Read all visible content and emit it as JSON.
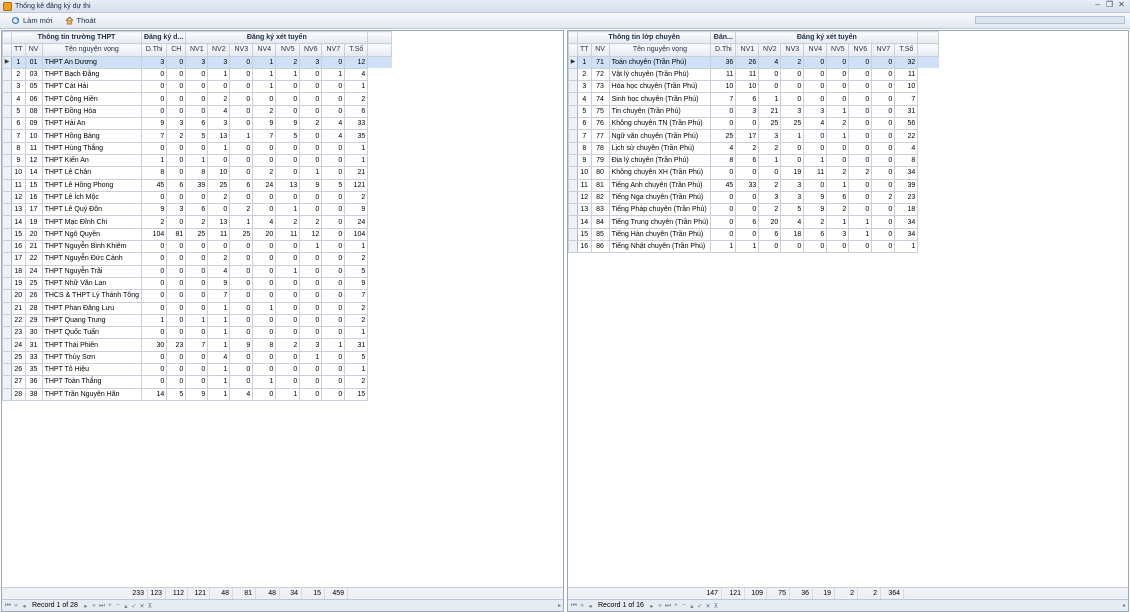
{
  "window": {
    "title": "Thống kê đăng ký dự thi"
  },
  "toolbar": {
    "refresh_label": "Làm mới",
    "exit_label": "Thoát"
  },
  "left_grid": {
    "band": [
      "Thông tin trường THPT",
      "Đăng ký d...",
      "Đăng ký xét tuyển"
    ],
    "columns": [
      "TT",
      "NV",
      "Tên nguyện vọng",
      "D.Thi",
      "CH",
      "NV1",
      "NV2",
      "NV3",
      "NV4",
      "NV5",
      "NV6",
      "NV7",
      "T.Số"
    ],
    "rows": [
      [
        "1",
        "01",
        "THPT An Dương",
        "3",
        "0",
        "3",
        "3",
        "0",
        "1",
        "2",
        "3",
        "0",
        "12"
      ],
      [
        "2",
        "03",
        "THPT Bạch Đằng",
        "0",
        "0",
        "0",
        "1",
        "0",
        "1",
        "1",
        "0",
        "1",
        "4"
      ],
      [
        "3",
        "05",
        "THPT Cát Hải",
        "0",
        "0",
        "0",
        "0",
        "0",
        "1",
        "0",
        "0",
        "0",
        "1"
      ],
      [
        "4",
        "06",
        "THPT Cộng Hiền",
        "0",
        "0",
        "0",
        "2",
        "0",
        "0",
        "0",
        "0",
        "0",
        "2"
      ],
      [
        "5",
        "08",
        "THPT Đồng Hòa",
        "0",
        "0",
        "0",
        "4",
        "0",
        "2",
        "0",
        "0",
        "0",
        "6"
      ],
      [
        "6",
        "09",
        "THPT Hải An",
        "9",
        "3",
        "6",
        "3",
        "0",
        "9",
        "9",
        "2",
        "4",
        "33"
      ],
      [
        "7",
        "10",
        "THPT Hồng Bàng",
        "7",
        "2",
        "5",
        "13",
        "1",
        "7",
        "5",
        "0",
        "4",
        "35"
      ],
      [
        "8",
        "11",
        "THPT Hùng Thắng",
        "0",
        "0",
        "0",
        "1",
        "0",
        "0",
        "0",
        "0",
        "0",
        "1"
      ],
      [
        "9",
        "12",
        "THPT Kiến An",
        "1",
        "0",
        "1",
        "0",
        "0",
        "0",
        "0",
        "0",
        "0",
        "1"
      ],
      [
        "10",
        "14",
        "THPT Lê Chân",
        "8",
        "0",
        "8",
        "10",
        "0",
        "2",
        "0",
        "1",
        "0",
        "21"
      ],
      [
        "11",
        "15",
        "THPT Lê Hồng Phong",
        "45",
        "6",
        "39",
        "25",
        "6",
        "24",
        "13",
        "9",
        "5",
        "121"
      ],
      [
        "12",
        "16",
        "THPT Lê Ích Mộc",
        "0",
        "0",
        "0",
        "2",
        "0",
        "0",
        "0",
        "0",
        "0",
        "2"
      ],
      [
        "13",
        "17",
        "THPT Lê Quý Đôn",
        "9",
        "3",
        "6",
        "0",
        "2",
        "0",
        "1",
        "0",
        "0",
        "9"
      ],
      [
        "14",
        "19",
        "THPT Mạc Đĩnh Chi",
        "2",
        "0",
        "2",
        "13",
        "1",
        "4",
        "2",
        "2",
        "0",
        "24"
      ],
      [
        "15",
        "20",
        "THPT Ngô Quyền",
        "104",
        "81",
        "25",
        "11",
        "25",
        "20",
        "11",
        "12",
        "0",
        "104"
      ],
      [
        "16",
        "21",
        "THPT Nguyễn Bỉnh Khiêm",
        "0",
        "0",
        "0",
        "0",
        "0",
        "0",
        "0",
        "1",
        "0",
        "1"
      ],
      [
        "17",
        "22",
        "THPT Nguyễn Đức Cảnh",
        "0",
        "0",
        "0",
        "2",
        "0",
        "0",
        "0",
        "0",
        "0",
        "2"
      ],
      [
        "18",
        "24",
        "THPT Nguyễn Trãi",
        "0",
        "0",
        "0",
        "4",
        "0",
        "0",
        "1",
        "0",
        "0",
        "5"
      ],
      [
        "19",
        "25",
        "THPT Nhữ Văn Lan",
        "0",
        "0",
        "0",
        "9",
        "0",
        "0",
        "0",
        "0",
        "0",
        "9"
      ],
      [
        "20",
        "26",
        "THCS & THPT Lý Thánh Tông",
        "0",
        "0",
        "0",
        "7",
        "0",
        "0",
        "0",
        "0",
        "0",
        "7"
      ],
      [
        "21",
        "28",
        "THPT Phan Đăng Lưu",
        "0",
        "0",
        "0",
        "1",
        "0",
        "1",
        "0",
        "0",
        "0",
        "2"
      ],
      [
        "22",
        "29",
        "THPT Quang Trung",
        "1",
        "0",
        "1",
        "1",
        "0",
        "0",
        "0",
        "0",
        "0",
        "2"
      ],
      [
        "23",
        "30",
        "THPT Quốc Tuấn",
        "0",
        "0",
        "0",
        "1",
        "0",
        "0",
        "0",
        "0",
        "0",
        "1"
      ],
      [
        "24",
        "31",
        "THPT Thái Phiên",
        "30",
        "23",
        "7",
        "1",
        "9",
        "8",
        "2",
        "3",
        "1",
        "31"
      ],
      [
        "25",
        "33",
        "THPT Thủy Sơn",
        "0",
        "0",
        "0",
        "4",
        "0",
        "0",
        "0",
        "1",
        "0",
        "5"
      ],
      [
        "26",
        "35",
        "THPT Tô Hiệu",
        "0",
        "0",
        "0",
        "1",
        "0",
        "0",
        "0",
        "0",
        "0",
        "1"
      ],
      [
        "27",
        "36",
        "THPT Toàn Thắng",
        "0",
        "0",
        "0",
        "1",
        "0",
        "1",
        "0",
        "0",
        "0",
        "2"
      ],
      [
        "28",
        "38",
        "THPT Trần Nguyên Hãn",
        "14",
        "5",
        "9",
        "1",
        "4",
        "0",
        "1",
        "0",
        "0",
        "15"
      ]
    ],
    "totals": [
      "233",
      "123",
      "112",
      "121",
      "48",
      "81",
      "48",
      "34",
      "15",
      "459"
    ],
    "record_text": "Record 1 of 28"
  },
  "right_grid": {
    "band": [
      "Thông tin lớp chuyên",
      "Đăn...",
      "Đăng ký xét tuyển"
    ],
    "columns": [
      "TT",
      "NV",
      "Tên nguyện vọng",
      "D.Thi",
      "NV1",
      "NV2",
      "NV3",
      "NV4",
      "NV5",
      "NV6",
      "NV7",
      "T.Số"
    ],
    "rows": [
      [
        "1",
        "71",
        "Toán chuyên (Trần Phú)",
        "36",
        "26",
        "4",
        "2",
        "0",
        "0",
        "0",
        "0",
        "32"
      ],
      [
        "2",
        "72",
        "Vật lý chuyên (Trần Phú)",
        "11",
        "11",
        "0",
        "0",
        "0",
        "0",
        "0",
        "0",
        "11"
      ],
      [
        "3",
        "73",
        "Hóa học chuyên (Trần Phú)",
        "10",
        "10",
        "0",
        "0",
        "0",
        "0",
        "0",
        "0",
        "10"
      ],
      [
        "4",
        "74",
        "Sinh học chuyên (Trần Phú)",
        "7",
        "6",
        "1",
        "0",
        "0",
        "0",
        "0",
        "0",
        "7"
      ],
      [
        "5",
        "75",
        "Tin chuyên (Trần Phú)",
        "0",
        "3",
        "21",
        "3",
        "3",
        "1",
        "0",
        "0",
        "31"
      ],
      [
        "6",
        "76",
        "Không chuyên TN (Trần Phú)",
        "0",
        "0",
        "25",
        "25",
        "4",
        "2",
        "0",
        "0",
        "56"
      ],
      [
        "7",
        "77",
        "Ngữ văn chuyên (Trần Phú)",
        "25",
        "17",
        "3",
        "1",
        "0",
        "1",
        "0",
        "0",
        "22"
      ],
      [
        "8",
        "78",
        "Lịch sử chuyên (Trần Phú)",
        "4",
        "2",
        "2",
        "0",
        "0",
        "0",
        "0",
        "0",
        "4"
      ],
      [
        "9",
        "79",
        "Địa lý chuyên (Trần Phú)",
        "8",
        "6",
        "1",
        "0",
        "1",
        "0",
        "0",
        "0",
        "8"
      ],
      [
        "10",
        "80",
        "Không chuyên XH (Trần Phú)",
        "0",
        "0",
        "0",
        "19",
        "11",
        "2",
        "2",
        "0",
        "34"
      ],
      [
        "11",
        "81",
        "Tiếng Anh chuyên (Trần Phú)",
        "45",
        "33",
        "2",
        "3",
        "0",
        "1",
        "0",
        "0",
        "39"
      ],
      [
        "12",
        "82",
        "Tiếng Nga chuyên (Trần Phú)",
        "0",
        "0",
        "3",
        "3",
        "9",
        "6",
        "0",
        "2",
        "23"
      ],
      [
        "13",
        "83",
        "Tiếng Pháp chuyên (Trần Phú)",
        "0",
        "0",
        "2",
        "5",
        "9",
        "2",
        "0",
        "0",
        "18"
      ],
      [
        "14",
        "84",
        "Tiếng Trung chuyên (Trần Phú)",
        "0",
        "6",
        "20",
        "4",
        "2",
        "1",
        "1",
        "0",
        "34"
      ],
      [
        "15",
        "85",
        "Tiếng Hàn chuyên (Trần Phú)",
        "0",
        "0",
        "6",
        "18",
        "6",
        "3",
        "1",
        "0",
        "34"
      ],
      [
        "16",
        "86",
        "Tiếng Nhật chuyên (Trần Phú)",
        "1",
        "1",
        "0",
        "0",
        "0",
        "0",
        "0",
        "0",
        "1"
      ]
    ],
    "totals": [
      "147",
      "121",
      "109",
      "75",
      "36",
      "19",
      "2",
      "2",
      "364"
    ],
    "record_text": "Record 1 of 16"
  }
}
